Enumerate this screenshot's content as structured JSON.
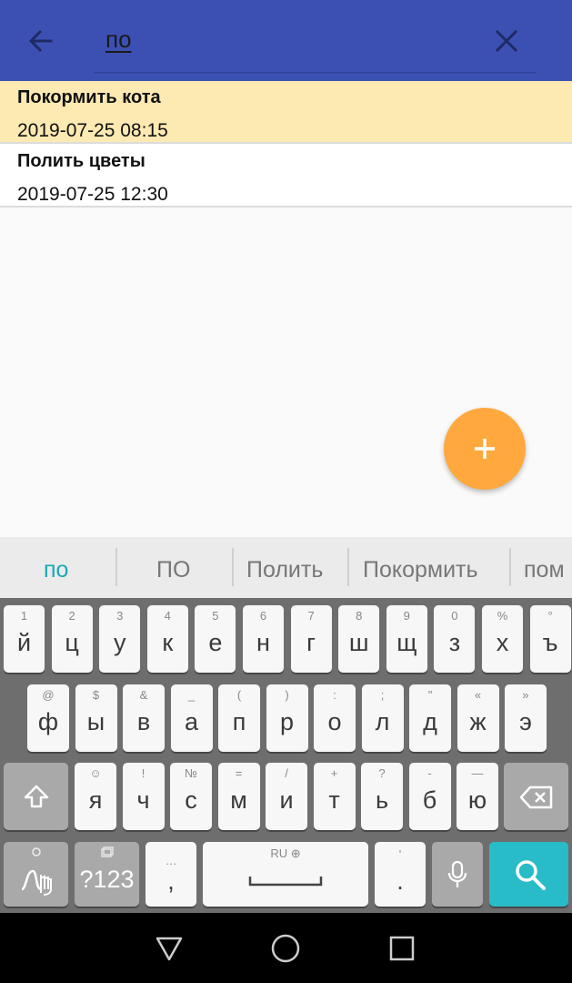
{
  "search": {
    "value": "по"
  },
  "tasks": [
    {
      "title": "Покормить кота",
      "datetime": "2019-07-25 08:15",
      "highlighted": true
    },
    {
      "title": "Полить цветы",
      "datetime": "2019-07-25 12:30",
      "highlighted": false
    }
  ],
  "fab": {
    "icon": "plus-icon",
    "color": "#ffa83e"
  },
  "theme": {
    "primary": "#3c50b4",
    "highlight": "#fde9b2",
    "keyboard_accent": "#27bcc7"
  },
  "keyboard": {
    "suggestions": [
      "по",
      "ПО",
      "Полить",
      "Покормить",
      "пом"
    ],
    "row1": [
      {
        "hint": "1",
        "key": "й"
      },
      {
        "hint": "2",
        "key": "ц"
      },
      {
        "hint": "3",
        "key": "у"
      },
      {
        "hint": "4",
        "key": "к"
      },
      {
        "hint": "5",
        "key": "е"
      },
      {
        "hint": "6",
        "key": "н"
      },
      {
        "hint": "7",
        "key": "г"
      },
      {
        "hint": "8",
        "key": "ш"
      },
      {
        "hint": "9",
        "key": "щ"
      },
      {
        "hint": "0",
        "key": "з"
      },
      {
        "hint": "%",
        "key": "х"
      },
      {
        "hint": "°",
        "key": "ъ"
      }
    ],
    "row2": [
      {
        "hint": "@",
        "key": "ф"
      },
      {
        "hint": "$",
        "key": "ы"
      },
      {
        "hint": "&",
        "key": "в"
      },
      {
        "hint": "_",
        "key": "а"
      },
      {
        "hint": "(",
        "key": "п"
      },
      {
        "hint": ")",
        "key": "р"
      },
      {
        "hint": ":",
        "key": "о"
      },
      {
        "hint": ";",
        "key": "л"
      },
      {
        "hint": "\"",
        "key": "д"
      },
      {
        "hint": "«",
        "key": "ж"
      },
      {
        "hint": "»",
        "key": "э"
      }
    ],
    "row3": [
      {
        "hint": "☺",
        "key": "я"
      },
      {
        "hint": "!",
        "key": "ч"
      },
      {
        "hint": "№",
        "key": "с"
      },
      {
        "hint": "=",
        "key": "м"
      },
      {
        "hint": "/",
        "key": "и"
      },
      {
        "hint": "+",
        "key": "т"
      },
      {
        "hint": "?",
        "key": "ь"
      },
      {
        "hint": "-",
        "key": "б"
      },
      {
        "hint": "—",
        "key": "ю"
      }
    ],
    "symbols_label": "?123",
    "comma_hint": "…",
    "comma": ",",
    "space_hint": "RU ⊕",
    "period_hint": "'",
    "period": "."
  }
}
